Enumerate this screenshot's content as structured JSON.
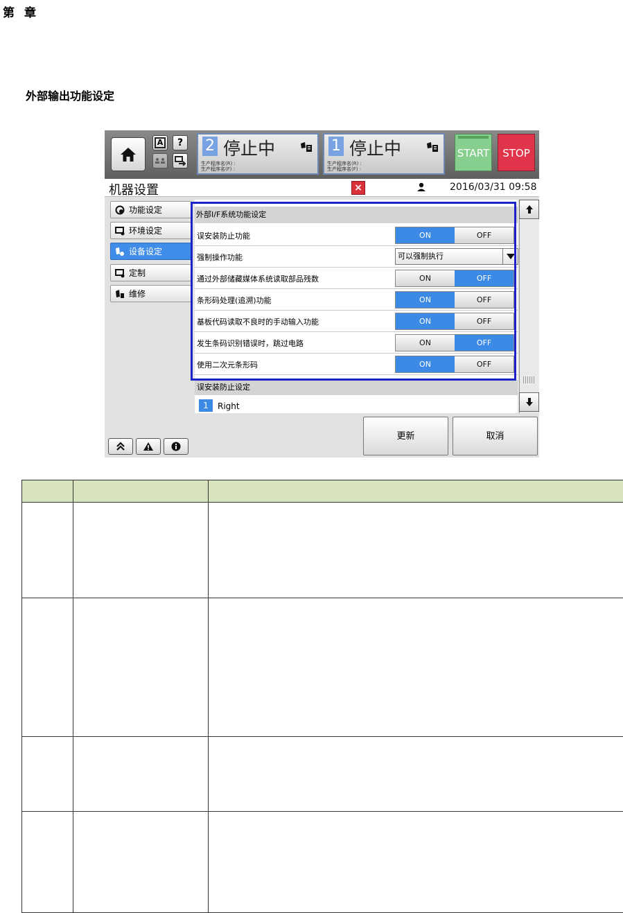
{
  "chapter": "第章",
  "section_title": "外部输出功能设定",
  "screen": {
    "topbar": {
      "status_panels": [
        {
          "number": "2",
          "text": "停止中",
          "sub_line1": "生产程序名(R) :",
          "sub_line2": "生产程序名(F) :"
        },
        {
          "number": "1",
          "text": "停止中",
          "sub_line1": "生产程序名(R) :",
          "sub_line2": "生产程序名(F) :"
        }
      ],
      "start_label": "START",
      "stop_label": "STOP",
      "small_btn_a": "A",
      "small_btn_help": "?"
    },
    "title": "机器设置",
    "close_label": "×",
    "datetime": "2016/03/31 09:58",
    "sidebar": [
      {
        "label": "功能设定",
        "active": false
      },
      {
        "label": "环境设定",
        "active": false
      },
      {
        "label": "设备设定",
        "active": true
      },
      {
        "label": "定制",
        "active": false
      },
      {
        "label": "维修",
        "active": false
      }
    ],
    "content_header": "外部I/F系统功能设定",
    "rows": [
      {
        "label": "误安装防止功能",
        "on": "ON",
        "off": "OFF",
        "selected": "ON"
      },
      {
        "label": "强制操作功能",
        "dropdown": "可以强制执行"
      },
      {
        "label": "通过外部储藏媒体系统读取部品残数",
        "on": "ON",
        "off": "OFF",
        "selected": "OFF"
      },
      {
        "label": "条形码处理(追溯)功能",
        "on": "ON",
        "off": "OFF",
        "selected": "ON"
      },
      {
        "label": "基板代码读取不良时的手动输入功能",
        "on": "ON",
        "off": "OFF",
        "selected": "ON"
      },
      {
        "label": "发生条码识别错误时，跳过电路",
        "on": "ON",
        "off": "OFF",
        "selected": "OFF"
      },
      {
        "label": "使用二次元条形码",
        "on": "ON",
        "off": "OFF",
        "selected": "ON"
      }
    ],
    "section2": "误安装防止设定",
    "right_item": {
      "number": "1",
      "text": "Right"
    },
    "update_label": "更新",
    "cancel_label": "取消",
    "colors": {
      "accent": "#3c8ae6",
      "highlight": "#1c23c8",
      "start": "#87cf8f",
      "stop": "#e0344a"
    }
  },
  "table": {
    "headers": [
      "",
      "",
      ""
    ],
    "rows": [
      [
        "",
        "",
        ""
      ],
      [
        "",
        "",
        ""
      ],
      [
        "",
        "",
        ""
      ],
      [
        "",
        "",
        ""
      ]
    ]
  }
}
